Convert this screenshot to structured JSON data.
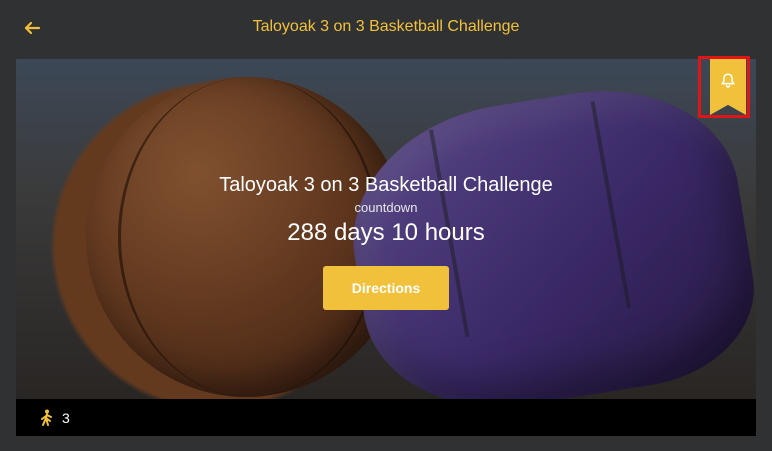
{
  "header": {
    "title": "Taloyoak 3 on 3 Basketball Challenge",
    "back_icon": "arrow-left-icon"
  },
  "hero": {
    "title": "Taloyoak 3 on 3 Basketball Challenge",
    "countdown_label": "countdown",
    "countdown_value": "288 days 10 hours",
    "directions_label": "Directions",
    "bell_icon": "bell-icon"
  },
  "footer": {
    "walker_icon": "walking-person-icon",
    "count": "3"
  },
  "colors": {
    "accent": "#f2c13b",
    "highlight": "#e01616",
    "background": "#2f3133"
  }
}
